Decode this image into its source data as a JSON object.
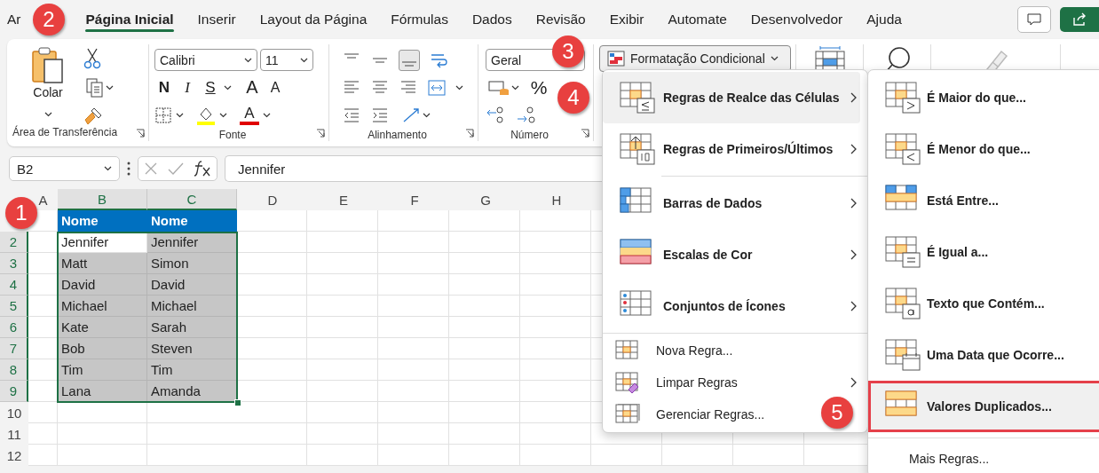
{
  "tabs": [
    {
      "label": "Ar",
      "selected": false
    },
    {
      "label": "Página Inicial",
      "selected": true
    },
    {
      "label": "Inserir",
      "selected": false
    },
    {
      "label": "Layout da Página",
      "selected": false
    },
    {
      "label": "Fórmulas",
      "selected": false
    },
    {
      "label": "Dados",
      "selected": false
    },
    {
      "label": "Revisão",
      "selected": false
    },
    {
      "label": "Exibir",
      "selected": false
    },
    {
      "label": "Automate",
      "selected": false
    },
    {
      "label": "Desenvolvedor",
      "selected": false
    },
    {
      "label": "Ajuda",
      "selected": false
    }
  ],
  "ribbon": {
    "clipboard": {
      "paste_label": "Colar",
      "group_label": "Área de Transferência"
    },
    "font": {
      "font_name": "Calibri",
      "font_size": "11",
      "bold": "N",
      "italic": "I",
      "underline": "S",
      "grow": "A",
      "shrink": "A",
      "color_letter": "A",
      "group_label": "Fonte"
    },
    "alignment": {
      "group_label": "Alinhamento"
    },
    "number": {
      "format": "Geral",
      "percent": "%",
      "group_label": "Número"
    },
    "conditional_formatting": {
      "label": "Formatação Condicional"
    }
  },
  "formula_bar": {
    "name_box": "B2",
    "formula": "Jennifer"
  },
  "sheet": {
    "columns": [
      {
        "label": "A",
        "selected": false
      },
      {
        "label": "B",
        "selected": true
      },
      {
        "label": "C",
        "selected": true
      },
      {
        "label": "D",
        "selected": false
      },
      {
        "label": "E",
        "selected": false
      },
      {
        "label": "F",
        "selected": false
      },
      {
        "label": "G",
        "selected": false
      },
      {
        "label": "H",
        "selected": false
      }
    ],
    "rows": [
      {
        "selected": false,
        "cells": [
          {
            "text": "Nome",
            "kind": "header"
          },
          {
            "text": "Nome",
            "kind": "header"
          }
        ]
      },
      {
        "number": "2",
        "selected": true,
        "cells": [
          {
            "text": "Jennifer",
            "kind": "active"
          },
          {
            "text": "Jennifer",
            "kind": "selected"
          }
        ]
      },
      {
        "number": "3",
        "selected": true,
        "cells": [
          {
            "text": "Matt",
            "kind": "selected"
          },
          {
            "text": "Simon",
            "kind": "selected"
          }
        ]
      },
      {
        "number": "4",
        "selected": true,
        "cells": [
          {
            "text": "David",
            "kind": "selected"
          },
          {
            "text": "David",
            "kind": "selected"
          }
        ]
      },
      {
        "number": "5",
        "selected": true,
        "cells": [
          {
            "text": "Michael",
            "kind": "selected"
          },
          {
            "text": "Michael",
            "kind": "selected"
          }
        ]
      },
      {
        "number": "6",
        "selected": true,
        "cells": [
          {
            "text": "Kate",
            "kind": "selected"
          },
          {
            "text": "Sarah",
            "kind": "selected"
          }
        ]
      },
      {
        "number": "7",
        "selected": true,
        "cells": [
          {
            "text": "Bob",
            "kind": "selected"
          },
          {
            "text": "Steven",
            "kind": "selected"
          }
        ]
      },
      {
        "number": "8",
        "selected": true,
        "cells": [
          {
            "text": "Tim",
            "kind": "selected"
          },
          {
            "text": "Tim",
            "kind": "selected"
          }
        ]
      },
      {
        "number": "9",
        "selected": true,
        "cells": [
          {
            "text": "Lana",
            "kind": "selected"
          },
          {
            "text": "Amanda",
            "kind": "selected"
          }
        ]
      },
      {
        "number": "10",
        "selected": false
      },
      {
        "number": "11",
        "selected": false
      },
      {
        "number": "12",
        "selected": false
      }
    ]
  },
  "menu": {
    "items": [
      {
        "label": "Regras de Realce das Células",
        "kind": "large",
        "submenu": true,
        "selected": true
      },
      {
        "label": "Regras de Primeiros/Últimos",
        "kind": "large",
        "submenu": true,
        "selected": false
      },
      {
        "label": "Barras de Dados",
        "kind": "large",
        "submenu": true,
        "selected": false
      },
      {
        "label": "Escalas de Cor",
        "kind": "large",
        "submenu": true,
        "selected": false
      },
      {
        "label": "Conjuntos de Ícones",
        "kind": "large",
        "submenu": true,
        "selected": false
      },
      {
        "label": "Nova Regra...",
        "kind": "small",
        "submenu": false,
        "selected": false
      },
      {
        "label": "Limpar Regras",
        "kind": "small",
        "submenu": true,
        "selected": false
      },
      {
        "label": "Gerenciar Regras...",
        "kind": "small",
        "submenu": false,
        "selected": false
      }
    ]
  },
  "submenu": {
    "items": [
      {
        "label": "É Maior do que...",
        "selected": false,
        "highlighted": false
      },
      {
        "label": "É Menor do que...",
        "selected": false,
        "highlighted": false
      },
      {
        "label": "Está Entre...",
        "selected": false,
        "highlighted": false
      },
      {
        "label": "É Igual a...",
        "selected": false,
        "highlighted": false
      },
      {
        "label": "Texto que Contém...",
        "selected": false,
        "highlighted": false
      },
      {
        "label": "Uma Data que Ocorre...",
        "selected": false,
        "highlighted": false
      },
      {
        "label": "Valores Duplicados...",
        "selected": true,
        "highlighted": true
      }
    ],
    "more": "Mais Regras..."
  },
  "annotations": [
    {
      "label": "1"
    },
    {
      "label": "2"
    },
    {
      "label": "3"
    },
    {
      "label": "4"
    },
    {
      "label": "5"
    }
  ]
}
